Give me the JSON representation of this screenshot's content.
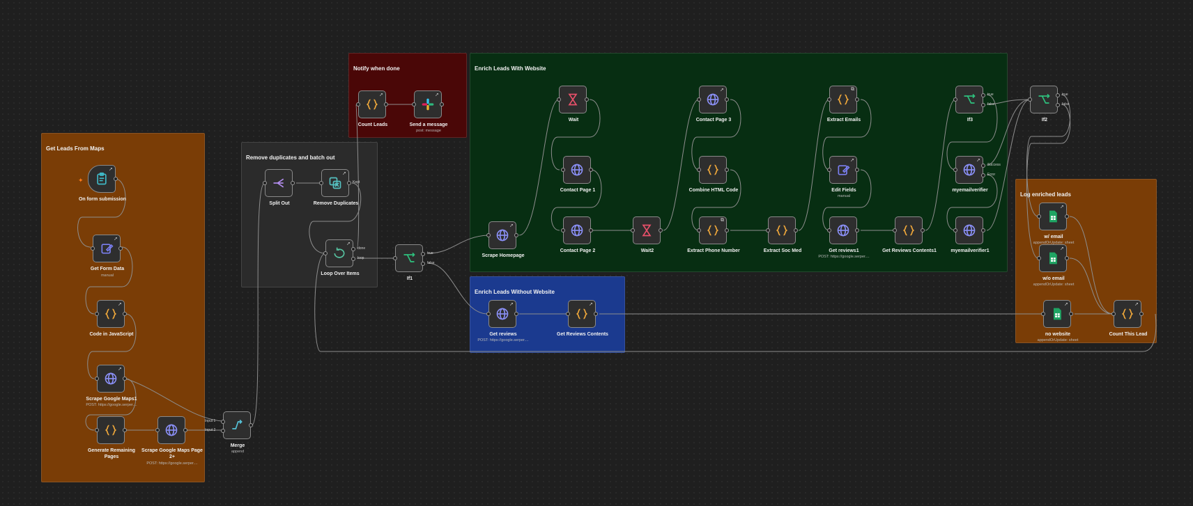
{
  "canvas": {
    "name": "n8n workflow canvas"
  },
  "groups": [
    {
      "id": "get-leads",
      "title": "Get Leads From Maps",
      "color": "#7a3d06"
    },
    {
      "id": "remove-dup",
      "title": "Remove duplicates and batch out",
      "color": "#2b2b2b"
    },
    {
      "id": "notify",
      "title": "Notify when done",
      "color": "#4a0707"
    },
    {
      "id": "enrich-website",
      "title": "Enrich Leads With Website",
      "color": "#072e12"
    },
    {
      "id": "enrich-no-website",
      "title": "Enrich Leads Without Website",
      "color": "#1b3a8f"
    },
    {
      "id": "log-leads",
      "title": "Log enriched leads",
      "color": "#7a3d06"
    }
  ],
  "nodes": {
    "on_form_submission": {
      "label": "On form submission",
      "icon": "clipboard-icon",
      "color": "#3fb8c6"
    },
    "get_form_data": {
      "label": "Get Form Data",
      "sub": "manual",
      "icon": "edit-icon",
      "color": "#7b7ff0"
    },
    "code_in_js": {
      "label": "Code in JavaScript",
      "icon": "code-braces-icon",
      "color": "#f1a93b"
    },
    "scrape_google_maps1": {
      "label": "Scrape Google Maps1",
      "sub": "POST: https://google.serper....",
      "icon": "globe-icon",
      "color": "#8a8ff5"
    },
    "generate_remaining": {
      "label": "Generate Remaining Pages",
      "icon": "code-braces-icon",
      "color": "#f1a93b"
    },
    "scrape_maps_page2": {
      "label": "Scrape Google Maps Page 2+",
      "sub": "POST: https://google.serper....",
      "icon": "globe-icon",
      "color": "#8a8ff5"
    },
    "merge": {
      "label": "Merge",
      "sub": "append",
      "icon": "merge-icon",
      "color": "#56c2d8",
      "inputs": [
        "Input 1",
        "Input 2"
      ]
    },
    "split_out": {
      "label": "Split Out",
      "icon": "split-icon",
      "color": "#b48ef0"
    },
    "remove_duplicates": {
      "label": "Remove Duplicates",
      "icon": "remove-duplicates-icon",
      "color": "#55c0c0",
      "outputs": [
        "Kept"
      ]
    },
    "loop_over_items": {
      "label": "Loop Over Items",
      "icon": "loop-icon",
      "color": "#56c2a0",
      "outputs": [
        "done",
        "loop"
      ]
    },
    "count_leads": {
      "label": "Count Leads",
      "icon": "code-braces-icon",
      "color": "#f1a93b"
    },
    "send_message": {
      "label": "Send a message",
      "sub": "post: message",
      "icon": "slack-icon",
      "color": "#e01e5a"
    },
    "if1": {
      "label": "If1",
      "icon": "if-icon",
      "color": "#2ec27e",
      "outputs": [
        "true",
        "false"
      ]
    },
    "scrape_homepage": {
      "label": "Scrape Homepage",
      "icon": "globe-icon",
      "color": "#8a8ff5"
    },
    "wait": {
      "label": "Wait",
      "icon": "hourglass-icon",
      "color": "#e8506a"
    },
    "contact_page1": {
      "label": "Contact Page 1",
      "icon": "globe-icon",
      "color": "#8a8ff5"
    },
    "contact_page2": {
      "label": "Contact Page 2",
      "icon": "globe-icon",
      "color": "#8a8ff5"
    },
    "wait2": {
      "label": "Wait2",
      "icon": "hourglass-icon",
      "color": "#e8506a"
    },
    "contact_page3": {
      "label": "Contact Page 3",
      "icon": "globe-icon",
      "color": "#8a8ff5"
    },
    "combine_html": {
      "label": "Combine HTML Code",
      "icon": "code-braces-icon",
      "color": "#f1a93b"
    },
    "extract_phone": {
      "label": "Extract Phone Number",
      "icon": "code-braces-icon",
      "color": "#f1a93b"
    },
    "extract_soc_med": {
      "label": "Extract Soc Med",
      "icon": "code-braces-icon",
      "color": "#f1a93b"
    },
    "extract_emails": {
      "label": "Extract Emails",
      "icon": "code-braces-icon",
      "color": "#f1a93b"
    },
    "edit_fields": {
      "label": "Edit Fields",
      "sub": "manual",
      "icon": "edit-icon",
      "color": "#7b7ff0"
    },
    "get_reviews1": {
      "label": "Get reviews1",
      "sub": "POST: https://google.serper....",
      "icon": "globe-icon",
      "color": "#8a8ff5"
    },
    "get_reviews_contents1": {
      "label": "Get Reviews Contents1",
      "icon": "code-braces-icon",
      "color": "#f1a93b"
    },
    "if3": {
      "label": "If3",
      "icon": "if-icon",
      "color": "#2ec27e",
      "outputs": [
        "true",
        "false"
      ]
    },
    "myemailverifier": {
      "label": "myemailverifier",
      "icon": "globe-icon",
      "color": "#8a8ff5",
      "outputs": [
        "Success",
        "Error"
      ]
    },
    "myemailverifier1": {
      "label": "myemailverifier1",
      "icon": "globe-icon",
      "color": "#8a8ff5"
    },
    "if2": {
      "label": "If2",
      "icon": "if-icon",
      "color": "#2ec27e",
      "outputs": [
        "true",
        "false"
      ]
    },
    "get_reviews": {
      "label": "Get reviews",
      "sub": "POST: https://google.serper....",
      "icon": "globe-icon",
      "color": "#8a8ff5"
    },
    "get_reviews_contents": {
      "label": "Get Reviews Contents",
      "icon": "code-braces-icon",
      "color": "#f1a93b"
    },
    "w_email": {
      "label": "w/ email",
      "sub": "appendOrUpdate: sheet",
      "icon": "sheets-icon",
      "color": "#1fa463"
    },
    "wo_email": {
      "label": "w/o email",
      "sub": "appendOrUpdate: sheet",
      "icon": "sheets-icon",
      "color": "#1fa463"
    },
    "no_website": {
      "label": "no website",
      "sub": "appendOrUpdate: sheet",
      "icon": "sheets-icon",
      "color": "#1fa463"
    },
    "count_this_lead": {
      "label": "Count This Lead",
      "icon": "code-braces-icon",
      "color": "#f1a93b"
    }
  }
}
